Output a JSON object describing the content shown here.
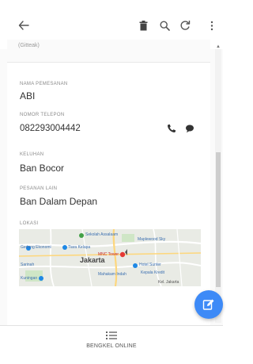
{
  "app_bar": {
    "back_icon": "arrow-left-icon",
    "actions": [
      "delete-icon",
      "search-icon",
      "refresh-icon",
      "more-vert-icon"
    ]
  },
  "order": {
    "top_partial_text": "(Gitteak)",
    "nama_pemesanan": {
      "label": "NAMA PEMESANAN",
      "value": "ABI"
    },
    "nomor_telepon": {
      "label": "NOMOR TELEPON",
      "value": "082293004442"
    },
    "keluhan": {
      "label": "KELUHAN",
      "value": "Ban Bocor"
    },
    "pesanan_lain": {
      "label": "PESANAN LAIN",
      "value": "Ban Dalam Depan"
    },
    "lokasi": {
      "label": "LOKASI",
      "map_city": "Jakarta",
      "map_places": [
        "Sekolah Assalaam",
        "Maplewood Sky",
        "Tiara Kelapa",
        "MNC Tower",
        "Gedung Ekonomi",
        "Hotel Sunter",
        "Sarinah",
        "Kepala Kredit",
        "Kuningan",
        "Mahakam Indah",
        "Kel. Jakarta"
      ]
    }
  },
  "fab": {
    "icon": "edit-icon"
  },
  "bottom_nav": {
    "icon": "list-icon",
    "label": "BENGKEL ONLINE"
  },
  "colors": {
    "accent": "#3d8af7",
    "phone_icon": "#333333",
    "text": "#333333"
  }
}
